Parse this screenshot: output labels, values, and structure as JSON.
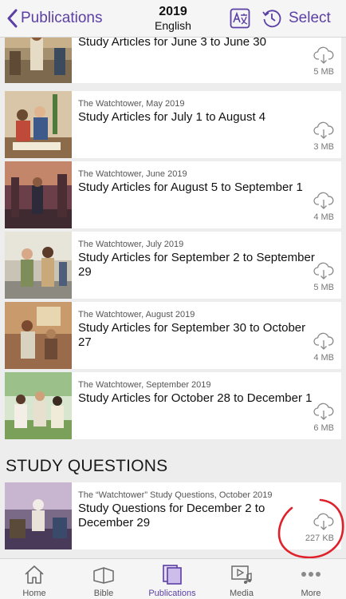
{
  "navbar": {
    "back_label": "Publications",
    "year": "2019",
    "language": "English",
    "select_label": "Select"
  },
  "items": [
    {
      "subtitle": "",
      "title": "Study Articles for June 3 to June 30",
      "size": "5 MB"
    },
    {
      "subtitle": "The Watchtower, May 2019",
      "title": "Study Articles for July 1 to August 4",
      "size": "3 MB"
    },
    {
      "subtitle": "The Watchtower, June 2019",
      "title": "Study Articles for August 5 to September 1",
      "size": "4 MB"
    },
    {
      "subtitle": "The Watchtower, July 2019",
      "title": "Study Articles for September 2 to September 29",
      "size": "5 MB"
    },
    {
      "subtitle": "The Watchtower, August 2019",
      "title": "Study Articles for September 30 to October 27",
      "size": "4 MB"
    },
    {
      "subtitle": "The Watchtower, September 2019",
      "title": "Study Articles for October 28 to December 1",
      "size": "6 MB"
    }
  ],
  "study_questions": {
    "header": "STUDY QUESTIONS",
    "item": {
      "subtitle": "The “Watchtower” Study Questions, October 2019",
      "title": "Study Questions for December 2 to December 29",
      "size": "227 KB"
    }
  },
  "tabs": [
    {
      "label": "Home",
      "icon": "home-icon"
    },
    {
      "label": "Bible",
      "icon": "bible-icon"
    },
    {
      "label": "Publications",
      "icon": "publications-icon",
      "active": true
    },
    {
      "label": "Media",
      "icon": "media-icon"
    },
    {
      "label": "More",
      "icon": "more-icon"
    }
  ],
  "colors": {
    "accent": "#5b3fa5",
    "background": "#ededed",
    "card": "#ffffff",
    "annotation": "#e0212c"
  }
}
